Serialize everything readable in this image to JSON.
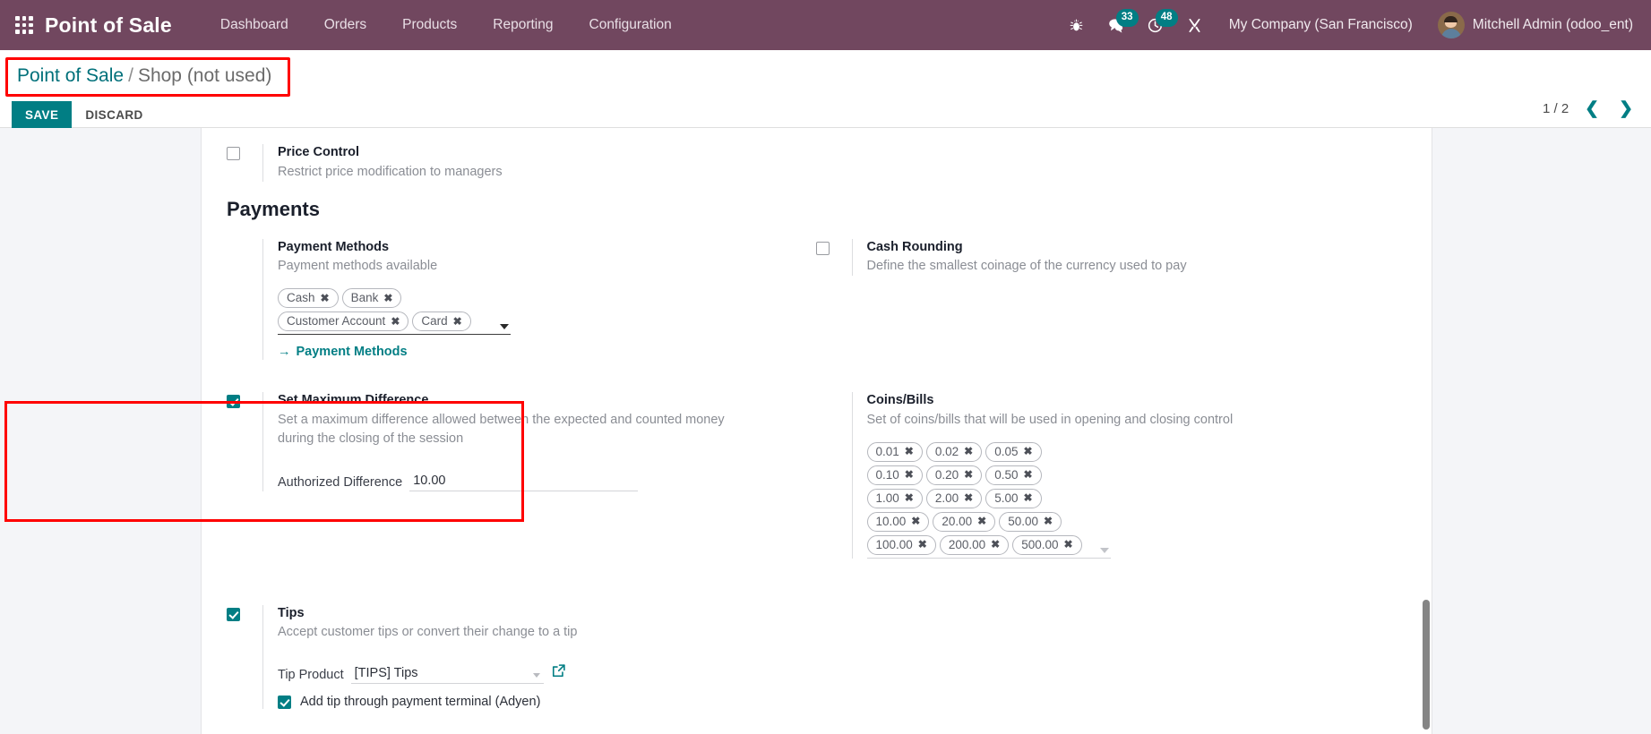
{
  "navbar": {
    "apps_icon": "apps-grid-icon",
    "brand": "Point of Sale",
    "menu": [
      {
        "label": "Dashboard"
      },
      {
        "label": "Orders"
      },
      {
        "label": "Products"
      },
      {
        "label": "Reporting"
      },
      {
        "label": "Configuration"
      }
    ],
    "sys_icons": [
      {
        "name": "bug-icon",
        "badge": ""
      },
      {
        "name": "messages-icon",
        "badge": "33"
      },
      {
        "name": "activities-clock-icon",
        "badge": "48"
      },
      {
        "name": "developer-tools-icon",
        "badge": ""
      }
    ],
    "company": "My Company (San Francisco)",
    "user": "Mitchell Admin (odoo_ent)",
    "bg_color": "#71475f",
    "badge_color": "#017e84"
  },
  "control_panel": {
    "breadcrumb_root": "Point of Sale",
    "breadcrumb_sep": "/",
    "breadcrumb_current": "Shop (not used)",
    "save_label": "SAVE",
    "discard_label": "DISCARD",
    "pager_count": "1 / 2",
    "pager_prev": "❮",
    "pager_next": "❯",
    "highlight_color": "#ff0000",
    "accent_color": "#017e84"
  },
  "settings": {
    "price_control": {
      "title": "Price Control",
      "description": "Restrict price modification to managers",
      "checked": false
    },
    "payments_section_title": "Payments",
    "payment_methods": {
      "title": "Payment Methods",
      "description": "Payment methods available",
      "tags": [
        "Cash",
        "Bank",
        "Customer Account",
        "Card"
      ],
      "tag_remove_glyph": "✖",
      "internal_link": "Payment Methods",
      "internal_link_arrow": "→"
    },
    "cash_rounding": {
      "title": "Cash Rounding",
      "description": "Define the smallest coinage of the currency used to pay",
      "checked": false
    },
    "set_maximum_difference": {
      "title": "Set Maximum Difference",
      "description": "Set a maximum difference allowed between the expected and counted money during the closing of the session",
      "checked": true,
      "field_label": "Authorized Difference",
      "field_value": "10.00",
      "highlighted": true
    },
    "coins_bills": {
      "title": "Coins/Bills",
      "description": "Set of coins/bills that will be used in opening and closing control",
      "tags": [
        "0.01",
        "0.02",
        "0.05",
        "0.10",
        "0.20",
        "0.50",
        "1.00",
        "2.00",
        "5.00",
        "10.00",
        "20.00",
        "50.00",
        "100.00",
        "200.00",
        "500.00"
      ],
      "tag_remove_glyph": "✖"
    },
    "tips": {
      "title": "Tips",
      "description": "Accept customer tips or convert their change to a tip",
      "checked": true,
      "field_label": "Tip Product",
      "field_value": "[TIPS] Tips",
      "sub_check_label": "Add tip through payment terminal (Adyen)",
      "sub_checked": true,
      "external_link_icon": "external-link-icon"
    }
  }
}
